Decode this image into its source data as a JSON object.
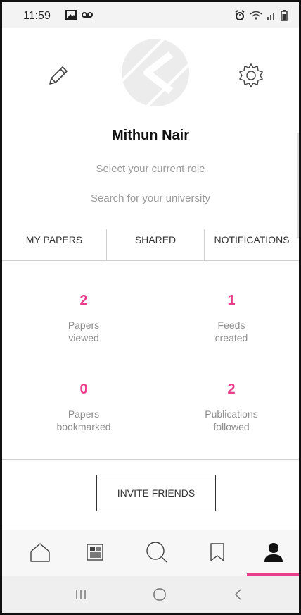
{
  "status_bar": {
    "time": "11:59"
  },
  "profile": {
    "name": "Mithun Nair",
    "role_placeholder": "Select your current role",
    "university_placeholder": "Search for your university"
  },
  "tabs": [
    {
      "label": "MY PAPERS"
    },
    {
      "label": "SHARED"
    },
    {
      "label": "NOTIFICATIONS"
    }
  ],
  "stats": [
    {
      "value": "2",
      "label": "Papers\nviewed"
    },
    {
      "value": "1",
      "label": "Feeds\ncreated"
    },
    {
      "value": "0",
      "label": "Papers\nbookmarked"
    },
    {
      "value": "2",
      "label": "Publications\nfollowed"
    }
  ],
  "actions": {
    "invite_label": "INVITE FRIENDS"
  },
  "bottom_nav": {
    "items": [
      "home-icon",
      "feed-icon",
      "search-icon",
      "bookmark-icon",
      "profile-icon"
    ],
    "active": "profile-icon"
  },
  "colors": {
    "accent": "#e83e8c"
  }
}
